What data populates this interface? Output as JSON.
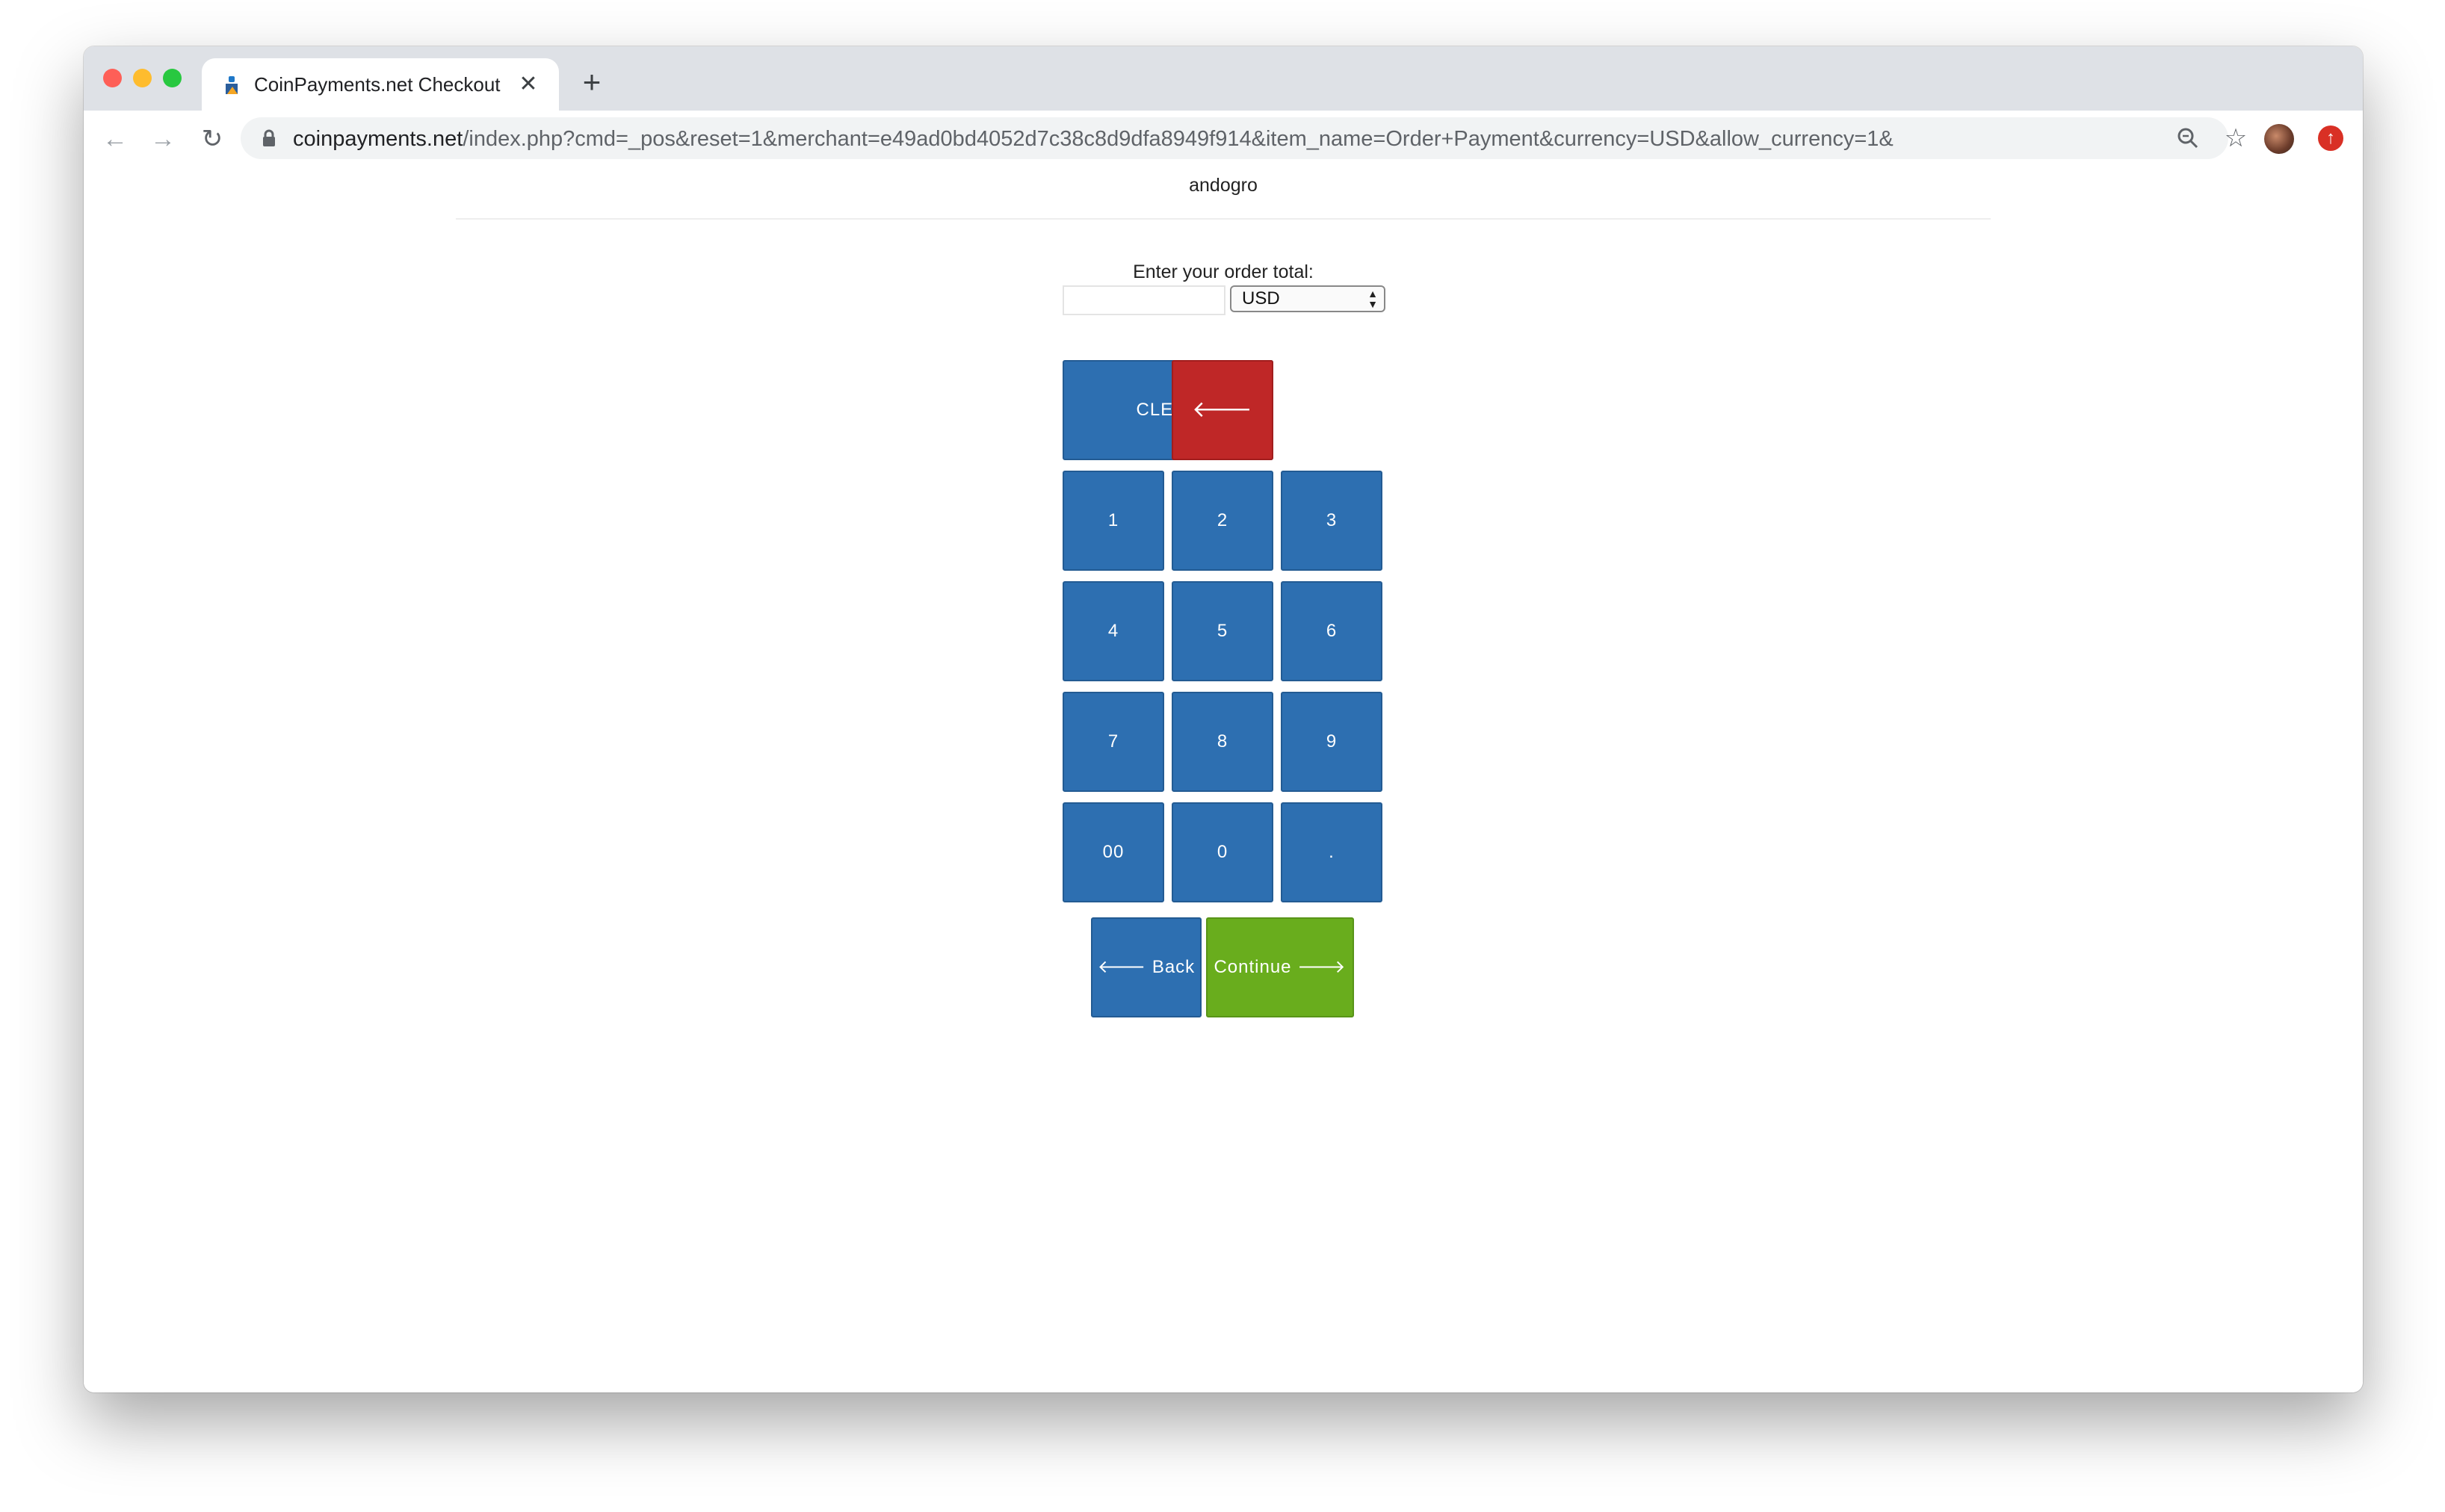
{
  "browser": {
    "tab_title": "CoinPayments.net Checkout",
    "tab_close": "✕",
    "new_tab": "+",
    "url_host": "coinpayments.net",
    "url_path": "/index.php?cmd=_pos&reset=1&merchant=e49ad0bd4052d7c38c8d9dfa8949f914&item_name=Order+Payment&currency=USD&allow_currency=1&",
    "nav_back": "←",
    "nav_forward": "→",
    "nav_reload": "↻",
    "star": "☆",
    "ext": "↑"
  },
  "page": {
    "merchant_name": "andogro",
    "prompt": "Enter your order total:",
    "amount_value": "",
    "currency_selected": "USD"
  },
  "keypad": {
    "clear": "CLEAR",
    "backspace": "🡐",
    "k1": "1",
    "k2": "2",
    "k3": "3",
    "k4": "4",
    "k5": "5",
    "k6": "6",
    "k7": "7",
    "k8": "8",
    "k9": "9",
    "k00": "00",
    "k0": "0",
    "kdot": "."
  },
  "actions": {
    "back": "🡐 Back",
    "continue": "Continue 🡒"
  },
  "colors": {
    "key_blue": "#2d6fb1",
    "key_red": "#bf2727",
    "key_green": "#69ad1d"
  }
}
